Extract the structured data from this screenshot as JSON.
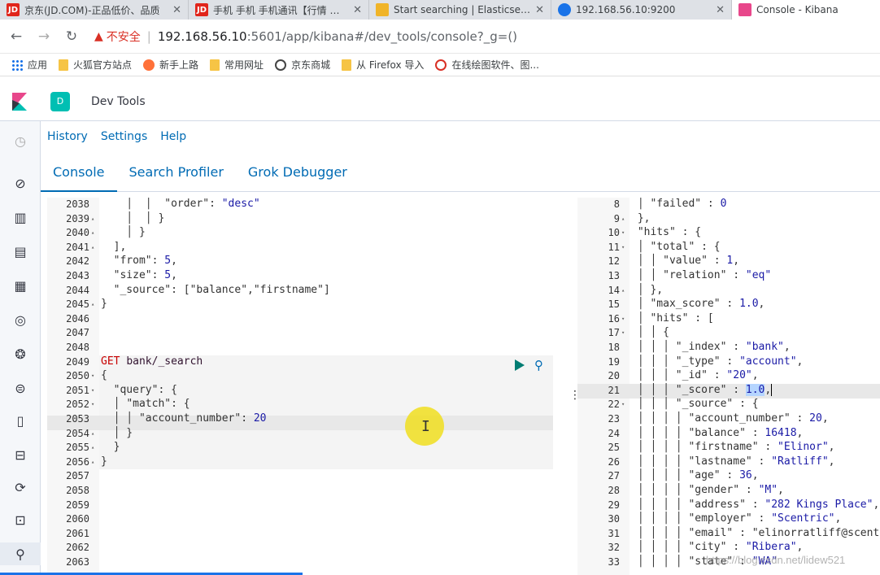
{
  "browser": {
    "tabs": [
      {
        "title": "京东(JD.COM)-正品低价、品质",
        "icon": "jd-icon",
        "color": "#e1251b"
      },
      {
        "title": "手机 手机 手机通讯【行情 价格",
        "icon": "jd-icon",
        "color": "#e1251b"
      },
      {
        "title": "Start searching | Elasticsearch",
        "icon": "elastic-icon",
        "color": "#f0b429"
      },
      {
        "title": "192.168.56.10:9200",
        "icon": "globe-icon",
        "color": "#1a73e8"
      },
      {
        "title": "Console - Kibana",
        "icon": "kibana-icon",
        "color": "#e8478b"
      }
    ],
    "close_glyph": "✕",
    "address": {
      "insecure_label": "不安全",
      "host": "192.168.56.10",
      "path": ":5601/app/kibana#/dev_tools/console?_g=()"
    },
    "bookmarks": [
      {
        "label": "应用",
        "icon": "apps-grid-icon"
      },
      {
        "label": "火狐官方站点",
        "icon": "folder-icon"
      },
      {
        "label": "新手上路",
        "icon": "firefox-icon"
      },
      {
        "label": "常用网址",
        "icon": "folder-icon"
      },
      {
        "label": "京东商城",
        "icon": "globe-icon"
      },
      {
        "label": "从 Firefox 导入",
        "icon": "folder-icon"
      },
      {
        "label": "在线绘图软件、图...",
        "icon": "drawing-icon"
      }
    ]
  },
  "kibana": {
    "space_initial": "D",
    "breadcrumb": "Dev Tools",
    "subnav": [
      "History",
      "Settings",
      "Help"
    ],
    "tabs": [
      "Console",
      "Search Profiler",
      "Grok Debugger"
    ],
    "selected_tab": "Console"
  },
  "editor": {
    "lines": [
      {
        "no": "2038",
        "fold": "",
        "code": "    │  │  \"order\": \"desc\""
      },
      {
        "no": "2039",
        "fold": "▴",
        "code": "    │  │ }"
      },
      {
        "no": "2040",
        "fold": "▴",
        "code": "    │ }"
      },
      {
        "no": "2041",
        "fold": "▴",
        "code": "  ],"
      },
      {
        "no": "2042",
        "fold": "",
        "code": "  \"from\": 5,"
      },
      {
        "no": "2043",
        "fold": "",
        "code": "  \"size\": 5,"
      },
      {
        "no": "2044",
        "fold": "",
        "code": "  \"_source\": [\"balance\",\"firstname\"]"
      },
      {
        "no": "2045",
        "fold": "▴",
        "code": "}"
      },
      {
        "no": "2046",
        "fold": "",
        "code": ""
      },
      {
        "no": "2047",
        "fold": "",
        "code": ""
      },
      {
        "no": "2048",
        "fold": "",
        "code": ""
      },
      {
        "no": "2049",
        "fold": "",
        "code": "GET bank/_search"
      },
      {
        "no": "2050",
        "fold": "▾",
        "code": "{"
      },
      {
        "no": "2051",
        "fold": "▾",
        "code": "  \"query\": {"
      },
      {
        "no": "2052",
        "fold": "▾",
        "code": "  │ \"match\": {"
      },
      {
        "no": "2053",
        "fold": "",
        "code": "  │ │ \"account_number\": 20"
      },
      {
        "no": "2054",
        "fold": "▴",
        "code": "  │ }"
      },
      {
        "no": "2055",
        "fold": "▴",
        "code": "  }"
      },
      {
        "no": "2056",
        "fold": "▴",
        "code": "}"
      },
      {
        "no": "2057",
        "fold": "",
        "code": ""
      },
      {
        "no": "2058",
        "fold": "",
        "code": ""
      },
      {
        "no": "2059",
        "fold": "",
        "code": ""
      },
      {
        "no": "2060",
        "fold": "",
        "code": ""
      },
      {
        "no": "2061",
        "fold": "",
        "code": ""
      },
      {
        "no": "2062",
        "fold": "",
        "code": ""
      },
      {
        "no": "2063",
        "fold": "",
        "code": ""
      }
    ]
  },
  "output": {
    "lines": [
      {
        "no": "8",
        "fold": "",
        "code": " │ \"failed\" : 0"
      },
      {
        "no": "9",
        "fold": "▴",
        "code": " },"
      },
      {
        "no": "10",
        "fold": "▾",
        "code": " \"hits\" : {"
      },
      {
        "no": "11",
        "fold": "▾",
        "code": " │ \"total\" : {"
      },
      {
        "no": "12",
        "fold": "",
        "code": " │ │ \"value\" : 1,"
      },
      {
        "no": "13",
        "fold": "",
        "code": " │ │ \"relation\" : \"eq\""
      },
      {
        "no": "14",
        "fold": "▴",
        "code": " │ },"
      },
      {
        "no": "15",
        "fold": "",
        "code": " │ \"max_score\" : 1.0,"
      },
      {
        "no": "16",
        "fold": "▾",
        "code": " │ \"hits\" : ["
      },
      {
        "no": "17",
        "fold": "▾",
        "code": " │ │ {"
      },
      {
        "no": "18",
        "fold": "",
        "code": " │ │ │ \"_index\" : \"bank\","
      },
      {
        "no": "19",
        "fold": "",
        "code": " │ │ │ \"_type\" : \"account\","
      },
      {
        "no": "20",
        "fold": "",
        "code": " │ │ │ \"_id\" : \"20\","
      },
      {
        "no": "21",
        "fold": "",
        "code": " │ │ │ \"_score\" : 1.0,"
      },
      {
        "no": "22",
        "fold": "▾",
        "code": " │ │ │ \"_source\" : {"
      },
      {
        "no": "23",
        "fold": "",
        "code": " │ │ │ │ \"account_number\" : 20,"
      },
      {
        "no": "24",
        "fold": "",
        "code": " │ │ │ │ \"balance\" : 16418,"
      },
      {
        "no": "25",
        "fold": "",
        "code": " │ │ │ │ \"firstname\" : \"Elinor\","
      },
      {
        "no": "26",
        "fold": "",
        "code": " │ │ │ │ \"lastname\" : \"Ratliff\","
      },
      {
        "no": "27",
        "fold": "",
        "code": " │ │ │ │ \"age\" : 36,"
      },
      {
        "no": "28",
        "fold": "",
        "code": " │ │ │ │ \"gender\" : \"M\","
      },
      {
        "no": "29",
        "fold": "",
        "code": " │ │ │ │ \"address\" : \"282 Kings Place\","
      },
      {
        "no": "30",
        "fold": "",
        "code": " │ │ │ │ \"employer\" : \"Scentric\","
      },
      {
        "no": "31",
        "fold": "",
        "code": " │ │ │ │ \"email\" : \"elinorratliff@scentric"
      },
      {
        "no": "32",
        "fold": "",
        "code": " │ │ │ │ \"city\" : \"Ribera\","
      },
      {
        "no": "33",
        "fold": "",
        "code": " │ │ │ │ \"state\" : \"WA\""
      }
    ]
  },
  "watermark": "https://blog.csdn.net/lidew521"
}
